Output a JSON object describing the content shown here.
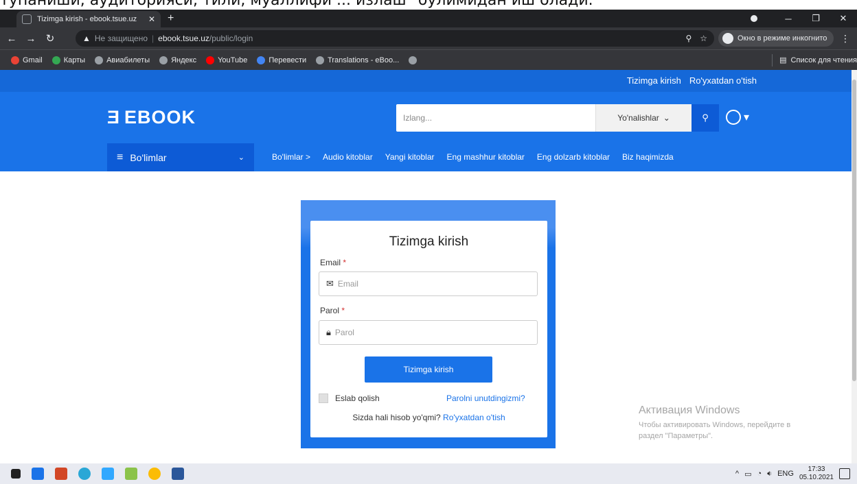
{
  "clipped_text": "тупаниши, аудиторияси, тили, муаллифи ... излаш\" бўлимидан иш олади.",
  "browser": {
    "tab_title": "Tizimga kirish - ebook.tsue.uz",
    "new_tab": "+",
    "url_warning": "Не защищено",
    "url_host": "ebook.tsue.uz",
    "url_path": "/public/login",
    "incognito": "Окно в режиме инкогнито",
    "bookmarks": [
      {
        "label": "Gmail",
        "color": "#ea4335"
      },
      {
        "label": "Карты",
        "color": "#34a853"
      },
      {
        "label": "Авиабилеты",
        "color": "#9aa0a6"
      },
      {
        "label": "Яндекс",
        "color": "#9aa0a6"
      },
      {
        "label": "YouTube",
        "color": "#ff0000"
      },
      {
        "label": "Перевести",
        "color": "#4285f4"
      },
      {
        "label": "Translations - eBoo...",
        "color": "#9aa0a6"
      }
    ],
    "reading_list": "Список для чтения"
  },
  "site": {
    "top_links": [
      "Tizimga kirish",
      "Ro'yxatdan o'tish"
    ],
    "logo": "EBOOK",
    "search_placeholder": "Izlang...",
    "search_category": "Yo'nalishlar",
    "categories_button": "Bo'limlar",
    "nav_links": [
      "Bo'limlar >",
      "Audio kitoblar",
      "Yangi kitoblar",
      "Eng mashhur kitoblar",
      "Eng dolzarb kitoblar",
      "Biz haqimizda"
    ],
    "accent_color": "#1a73e8"
  },
  "login": {
    "title": "Tizimga kirish",
    "email_label": "Email",
    "email_placeholder": "Email",
    "password_label": "Parol",
    "password_placeholder": "Parol",
    "required_mark": "*",
    "submit": "Tizimga kirish",
    "remember": "Eslab qolish",
    "forgot": "Parolni unutdingizmi?",
    "no_account": "Sizda hali hisob yo'qmi?",
    "signup_link": "Ro'yxatdan o'tish"
  },
  "windows_activation": {
    "title": "Активация Windows",
    "line1": "Чтобы активировать Windows, перейдите в",
    "line2": "раздел \"Параметры\"."
  },
  "taskbar": {
    "tray_lang": "ENG",
    "time": "17:33",
    "date": "05.10.2021"
  }
}
